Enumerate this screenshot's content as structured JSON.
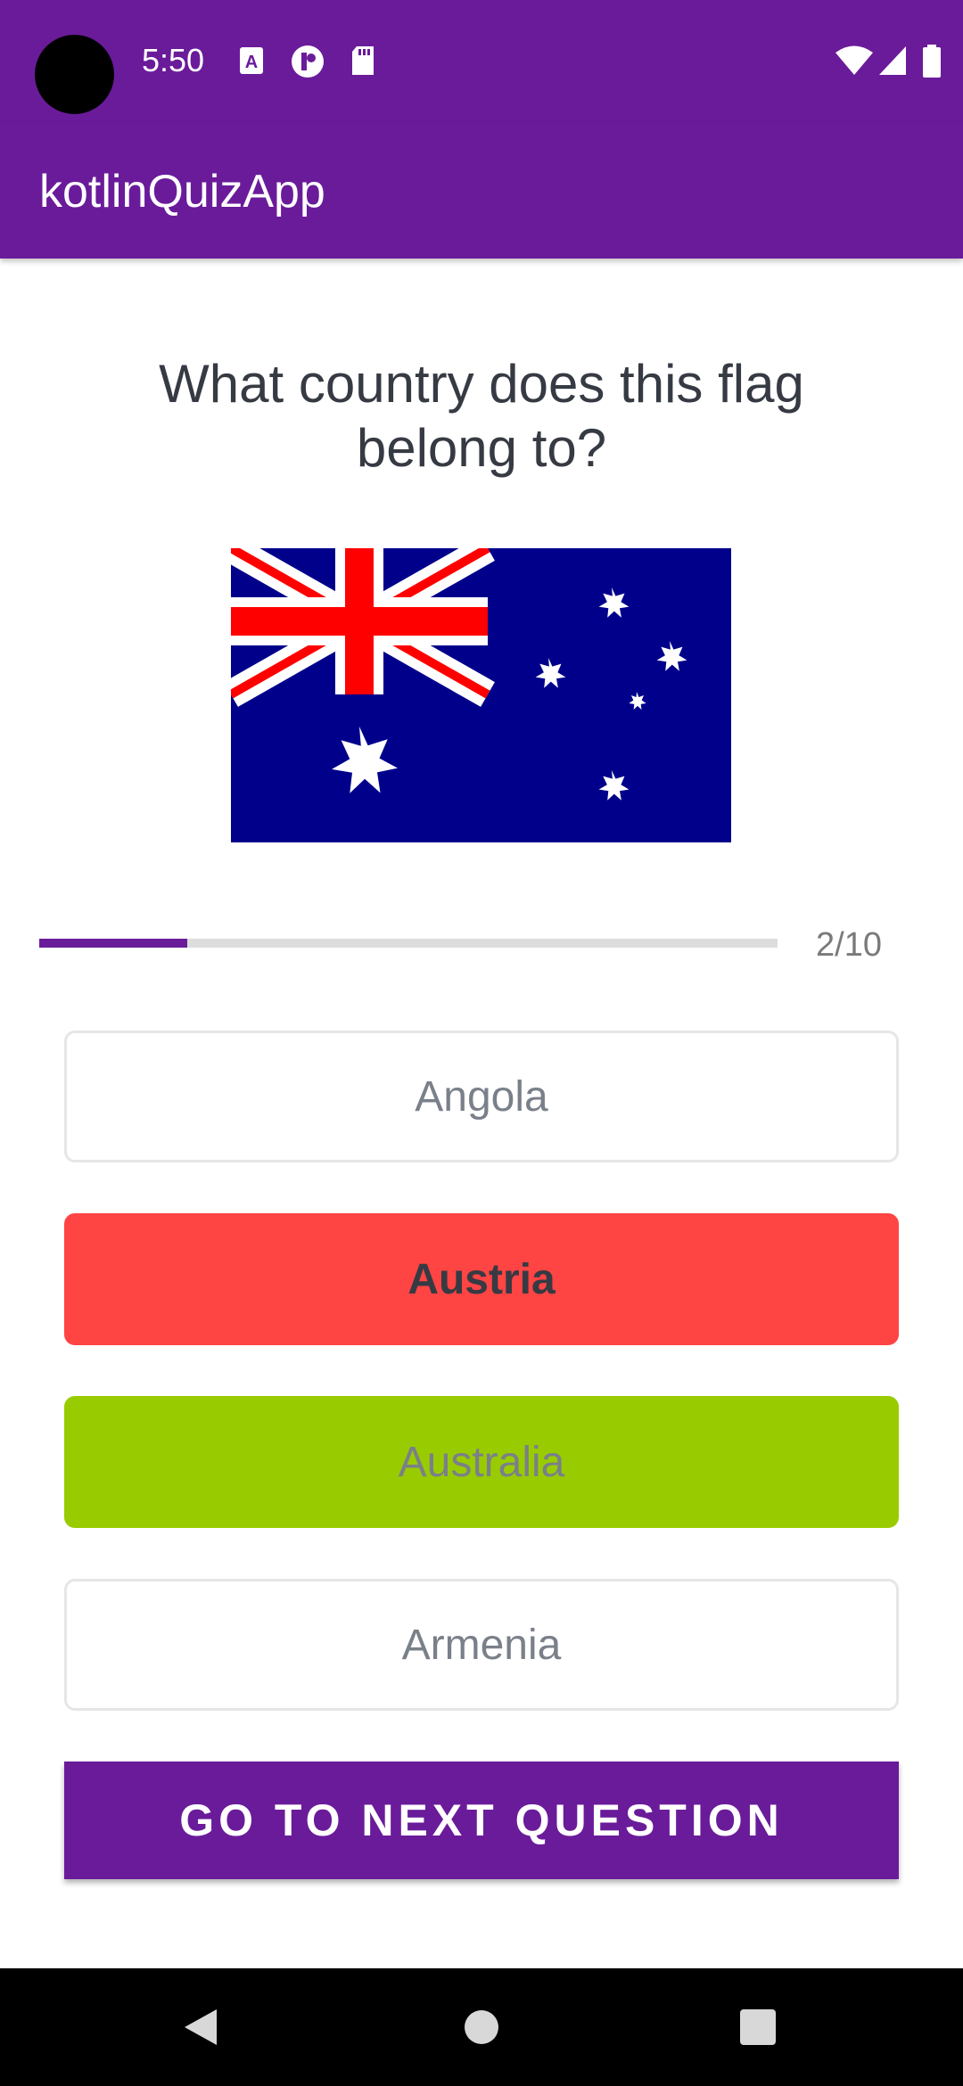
{
  "status_bar": {
    "time": "5:50",
    "left_icons": [
      "a-notification-icon",
      "notification-icon",
      "sd-card-icon"
    ],
    "right_icons": [
      "wifi-icon",
      "signal-icon",
      "battery-icon"
    ]
  },
  "app_bar": {
    "title": "kotlinQuizApp"
  },
  "question": {
    "text": "What country does this flag belong to?"
  },
  "flag": {
    "icon": "australia-flag",
    "colors": {
      "blue": "#00008b",
      "red": "#ff0000",
      "white": "#ffffff"
    }
  },
  "progress": {
    "current": 2,
    "total": 10,
    "label": "2/10"
  },
  "options": [
    {
      "label": "Angola",
      "state": "default"
    },
    {
      "label": "Austria",
      "state": "wrong"
    },
    {
      "label": "Australia",
      "state": "correct"
    },
    {
      "label": "Armenia",
      "state": "default"
    }
  ],
  "next_button": {
    "label": "GO TO NEXT QUESTION"
  },
  "colors": {
    "primary": "#6a1b9a",
    "wrong": "#ff4444",
    "correct": "#99cc00"
  },
  "nav_bar": {
    "icons": [
      "back-icon",
      "home-icon",
      "recents-icon"
    ]
  }
}
